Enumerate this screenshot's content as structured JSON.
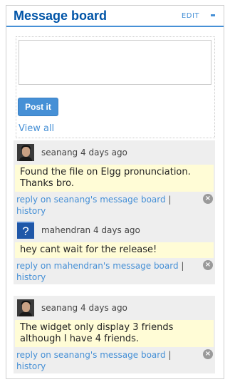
{
  "widget": {
    "title": "Message board",
    "edit_label": "EDIT"
  },
  "form": {
    "input_value": "",
    "post_label": "Post it",
    "view_all_label": "View  all"
  },
  "messages": [
    {
      "author": "seanang",
      "time": "4 days ago",
      "avatar": "user-photo",
      "body": "Found the file on Elgg pronunciation. Thanks bro.",
      "reply_label": "reply on seanang's message board",
      "separator": "|",
      "history_label": "history"
    },
    {
      "author": "mahendran",
      "time": "4 days ago",
      "avatar": "question-mark",
      "body": "hey cant wait for the release!",
      "reply_label": "reply on mahendran's message board",
      "separator": "|",
      "history_label": "history"
    },
    {
      "author": "seanang",
      "time": "4 days ago",
      "avatar": "user-photo",
      "body": "The widget only display 3 friends although I have 4 friends.",
      "reply_label": "reply on seanang's message board",
      "separator": "|",
      "history_label": "history"
    }
  ],
  "colors": {
    "accent": "#4690d6",
    "title": "#0054a7",
    "message_bg": "#eeeeee",
    "body_bg": "#fffcd6"
  }
}
